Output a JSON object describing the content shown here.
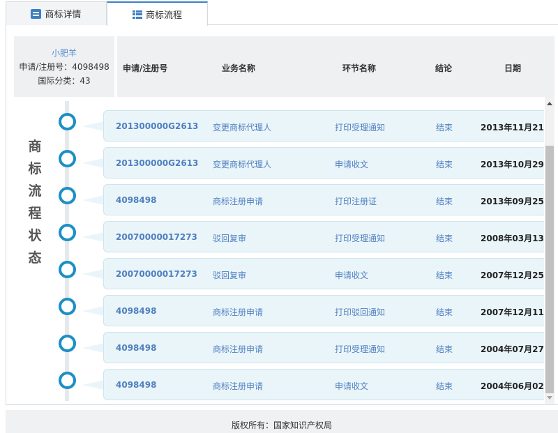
{
  "tabs": [
    {
      "label": "商标详情",
      "icon": "document-icon"
    },
    {
      "label": "商标流程",
      "icon": "list-icon"
    }
  ],
  "trademark": {
    "name": "小肥羊",
    "reg_line": "申请/注册号：4098498",
    "class_line": "国际分类：43"
  },
  "columns": [
    "申请/注册号",
    "业务名称",
    "环节名称",
    "结论",
    "日期"
  ],
  "vertical_title": [
    "商",
    "标",
    "流",
    "程",
    "状",
    "态"
  ],
  "rows": [
    {
      "no": "201300000G2613",
      "business": "变更商标代理人",
      "step": "打印受理通知",
      "result": "结束",
      "date": "2013年11月21日"
    },
    {
      "no": "201300000G2613",
      "business": "变更商标代理人",
      "step": "申请收文",
      "result": "结束",
      "date": "2013年10月29日"
    },
    {
      "no": "4098498",
      "business": "商标注册申请",
      "step": "打印注册证",
      "result": "结束",
      "date": "2013年09月25日"
    },
    {
      "no": "20070000017273",
      "business": "驳回复审",
      "step": "打印受理通知",
      "result": "结束",
      "date": "2008年03月13日"
    },
    {
      "no": "20070000017273",
      "business": "驳回复审",
      "step": "申请收文",
      "result": "结束",
      "date": "2007年12月25日"
    },
    {
      "no": "4098498",
      "business": "商标注册申请",
      "step": "打印驳回通知",
      "result": "结束",
      "date": "2007年12月11日"
    },
    {
      "no": "4098498",
      "business": "商标注册申请",
      "step": "打印受理通知",
      "result": "结束",
      "date": "2004年07月27日"
    },
    {
      "no": "4098498",
      "business": "商标注册申请",
      "step": "申请收文",
      "result": "结束",
      "date": "2004年06月02日"
    }
  ],
  "footer": "版权所有：国家知识产权局",
  "colors": {
    "accent": "#1b8fc5",
    "link": "#4f7fbf",
    "row_bg": "#eaf5fa"
  }
}
